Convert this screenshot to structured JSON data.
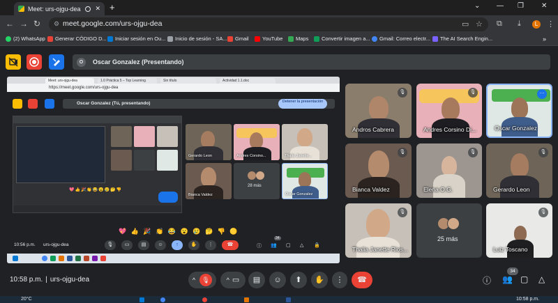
{
  "browser": {
    "tab_title": "Meet: urs-ojgu-dea",
    "url": "meet.google.com/urs-ojgu-dea",
    "new_tab": "+",
    "profile_initial": "L",
    "window_controls": [
      "⌄",
      "—",
      "❐",
      "✕"
    ]
  },
  "bookmarks": [
    {
      "label": "(2) WhatsApp",
      "color": "#25d366"
    },
    {
      "label": "Generar CÓDIGO D...",
      "color": "#ea4335"
    },
    {
      "label": "Iniciar sesión en Ou...",
      "color": "#0078d4"
    },
    {
      "label": "Inicio de sesión - SA...",
      "color": "#9aa0a6"
    },
    {
      "label": "Gmail",
      "color": "#ea4335"
    },
    {
      "label": "YouTube",
      "color": "#ff0000"
    },
    {
      "label": "Maps",
      "color": "#34a853"
    },
    {
      "label": "Convertir imagen a...",
      "color": "#0f9d58"
    },
    {
      "label": "Gmail: Correo electr...",
      "color": "#4285f4"
    },
    {
      "label": "The AI Search Engin...",
      "color": "#7b61ff"
    }
  ],
  "header": {
    "presenter_initial": "O",
    "presenter_label": "Oscar Gonzalez (Presentando)"
  },
  "shared_screen": {
    "inner_tabs": [
      "Meet: urs-ojgu-dea",
      "1.0 Práctica 5 – Top Learning",
      "Sin título",
      "Actividad 1.1.doc"
    ],
    "inner_url": "https://meet.google.com/urs-ojgu-dea",
    "inner_presenter": "Oscar Gonzalez (Tú, presentando)",
    "stop_button": "Detener la presentación",
    "tiles": [
      {
        "name": "Gerardo Leon"
      },
      {
        "name": "Andres Corsino..."
      },
      {
        "name": "Thalia Janette..."
      },
      {
        "name": "Bianca Valdez"
      },
      {
        "name": "28 más"
      },
      {
        "name": "Oscar Gonzalez"
      }
    ],
    "emojis": "💖 👍 🎉 👏 😂 😮 😢 🤔 👎 🟡",
    "inner_clock": "10:56 p.m.",
    "inner_code": "urs-ojgu-dea",
    "inner_count": "34"
  },
  "participants": [
    {
      "name": "Andros Cabrera",
      "bg": "#8a7d6c",
      "skin": "#b0866a"
    },
    {
      "name": "Andres Corsino Di...",
      "bg": "#e8b0b8",
      "skin": "#a77a5e"
    },
    {
      "name": "Oscar Gonzalez",
      "bg": "#dfe8e4",
      "skin": "#9c7458"
    },
    {
      "name": "Bianca Valdez",
      "bg": "#6b5a50",
      "skin": "#b58b6e"
    },
    {
      "name": "Elena O.G.",
      "bg": "#9c9590",
      "skin": "#d6b59c"
    },
    {
      "name": "Gerardo Leon",
      "bg": "#6e6458",
      "skin": "#a57c60"
    },
    {
      "name": "Thalia Janette Rios...",
      "bg": "#c7c0b8",
      "skin": "#d1a888"
    },
    {
      "name": "25 más",
      "bg": "#3c4043",
      "skin": ""
    },
    {
      "name": "Luiz Toscano",
      "bg": "#e9e9e7",
      "skin": "#8f6a52"
    }
  ],
  "bottom": {
    "time": "10:58 p.m.",
    "separator": "|",
    "meeting_code": "urs-ojgu-dea",
    "participants_count": "34"
  },
  "taskbar": {
    "temperature": "20°C",
    "time": "10:58 p.m."
  },
  "colors": {
    "end_call": "#ea4335",
    "mic_off": "#ea4335",
    "accent": "#8ab4f8",
    "meet_bg": "#202124"
  }
}
